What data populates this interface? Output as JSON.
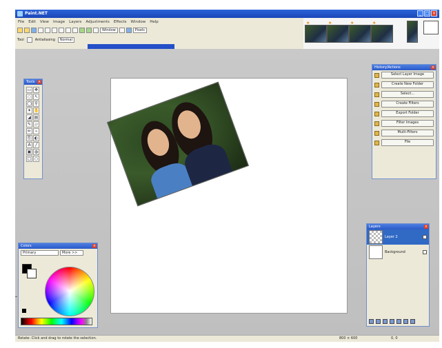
{
  "window": {
    "title": "Paint.NET"
  },
  "menu": [
    "File",
    "Edit",
    "View",
    "Image",
    "Layers",
    "Adjustments",
    "Effects",
    "Window",
    "Help"
  ],
  "toolbar": {
    "zoom_value": "Window",
    "units_value": "Pixels",
    "tool_label": "Tool",
    "antialias_label": "Antialiasing",
    "blend_label": "Normal"
  },
  "panels": {
    "tools": {
      "title": "Tools"
    },
    "colors": {
      "title": "Colors",
      "mode": "Primary",
      "more_button": "More >>"
    },
    "actions": {
      "title": "History/Actions",
      "buttons": [
        "Select Layer Image",
        "Create New Folder",
        "Select...",
        "Create Filters",
        "Export Folder",
        "Filter Images",
        "Multi-Filters",
        "File"
      ]
    },
    "layers": {
      "title": "Layers",
      "items": [
        {
          "name": "Layer 2",
          "selected": true
        },
        {
          "name": "Background",
          "selected": false
        }
      ]
    }
  },
  "statusbar": {
    "left": "Rotate: Click and drag to rotate the selection.",
    "size": "800 × 600",
    "coords": "0, 0"
  },
  "colors": {
    "accent": "#2350c8",
    "panel_bg": "#ece9d8",
    "workspace": "#c9c9c9"
  }
}
